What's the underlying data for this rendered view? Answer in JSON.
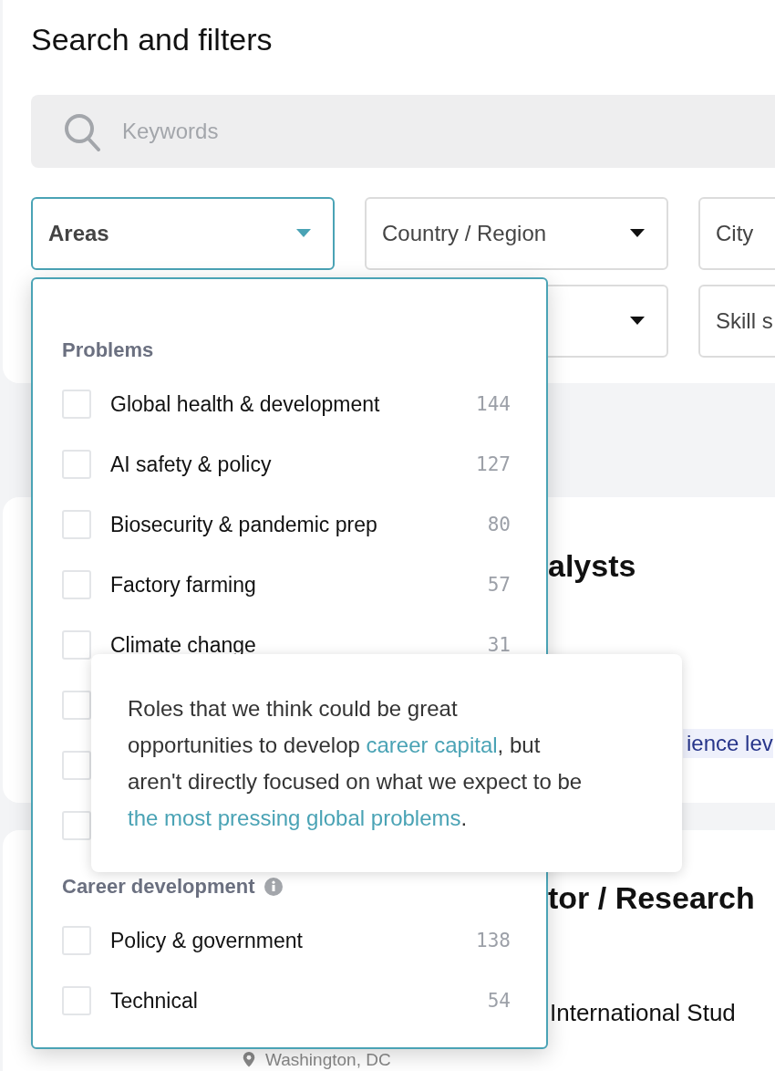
{
  "title": "Search and filters",
  "search": {
    "placeholder": "Keywords"
  },
  "filters": [
    {
      "label": "Areas",
      "open": true,
      "caret": true
    },
    {
      "label": "Country / Region",
      "open": false,
      "caret": true
    },
    {
      "label": "City",
      "open": false
    },
    {
      "open": false,
      "caret": true
    },
    {
      "label": "Skill s",
      "open": false
    }
  ],
  "areas_menu": {
    "groups": [
      {
        "heading": "Problems",
        "info": false,
        "items": [
          {
            "label": "Global health & development",
            "count": "144",
            "checked": false
          },
          {
            "label": "AI safety & policy",
            "count": "127",
            "checked": false
          },
          {
            "label": "Biosecurity & pandemic prep",
            "count": "80",
            "checked": false
          },
          {
            "label": "Factory farming",
            "count": "57",
            "checked": false
          },
          {
            "label": "Climate change",
            "count": "31",
            "checked": false
          },
          {
            "checked": false
          },
          {
            "checked": false
          },
          {
            "checked": false
          }
        ]
      },
      {
        "heading": "Career development",
        "info": true,
        "items": [
          {
            "label": "Policy & government",
            "count": "138",
            "checked": false
          },
          {
            "label": "Technical",
            "count": "54",
            "checked": false
          }
        ]
      }
    ]
  },
  "tooltip": {
    "parts": [
      {
        "kind": "text",
        "text": "Roles that we think could be great opportunities to develop "
      },
      {
        "kind": "link",
        "text": "career capital"
      },
      {
        "kind": "text",
        "text": ", but aren't directly focused on what we expect to be "
      },
      {
        "kind": "link",
        "text": "the most pressing global problems"
      },
      {
        "kind": "text",
        "text": "."
      }
    ]
  },
  "jobs": [
    {
      "title": "alysts",
      "tag": "ience lev"
    },
    {
      "title": "tor / Research",
      "organization": "International Stud",
      "location": "Washington, DC"
    }
  ]
}
